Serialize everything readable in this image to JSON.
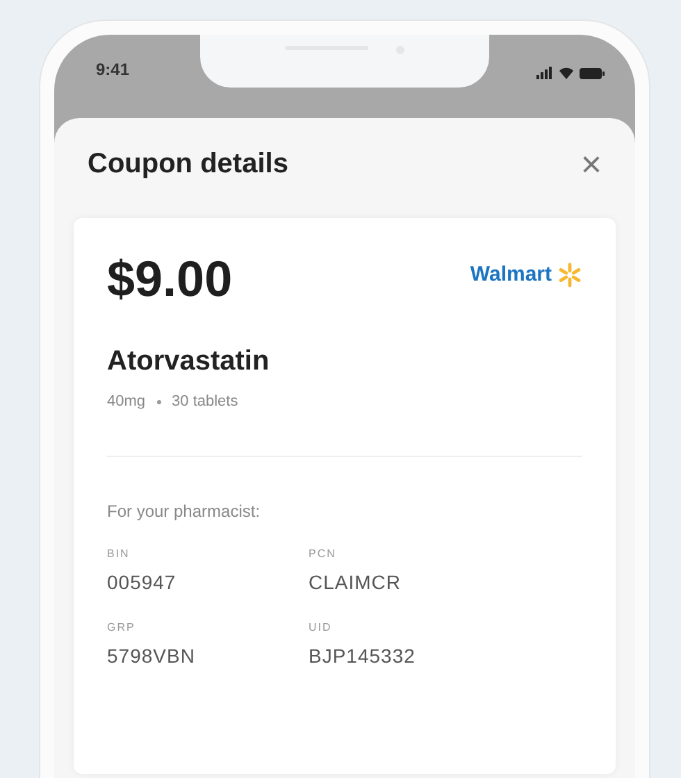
{
  "status_bar": {
    "time": "9:41"
  },
  "sheet": {
    "title": "Coupon details",
    "close": "×"
  },
  "coupon": {
    "price": "$9.00",
    "pharmacy": "Walmart",
    "drug": "Atorvastatin",
    "dose": "40mg",
    "quantity": "30 tablets",
    "pharmacist_heading": "For your pharmacist:",
    "fields": [
      {
        "label": "BIN",
        "value": "005947"
      },
      {
        "label": "PCN",
        "value": "CLAIMCR"
      },
      {
        "label": "GRP",
        "value": "5798VBN"
      },
      {
        "label": "UID",
        "value": "BJP145332"
      }
    ]
  }
}
